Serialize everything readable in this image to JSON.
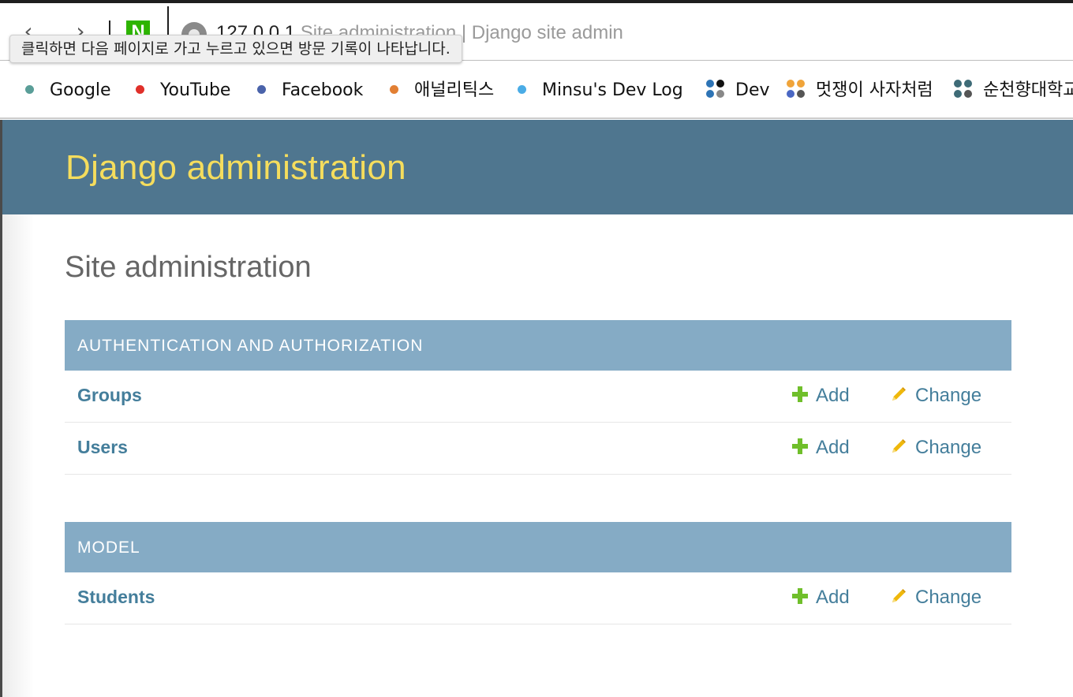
{
  "browser": {
    "back_glyph": "‹",
    "forward_glyph": "›",
    "naver_letter": "N",
    "url_host": "127.0.0.1",
    "tab_title": "Site administration | Django site admin",
    "tooltip": "클릭하면 다음 페이지로 가고 누르고 있으면 방문 기록이 나타납니다."
  },
  "bookmarks": [
    {
      "label": "Google",
      "color": "#5a9e98"
    },
    {
      "label": "YouTube",
      "color": "#e0302a"
    },
    {
      "label": "Facebook",
      "color": "#4a63aa"
    },
    {
      "label": "애널리틱스",
      "color": "#e27f33"
    },
    {
      "label": "Minsu's Dev Log",
      "color": "#4aace6"
    },
    {
      "label": "Dev",
      "colors": [
        "#2e74b5",
        "#111111",
        "#2e74b5",
        "#888888"
      ]
    },
    {
      "label": "멋쟁이 사자처럼",
      "colors": [
        "#f0a43a",
        "#f0a43a",
        "#4a67c3",
        "#555555"
      ]
    },
    {
      "label": "순천향대학교",
      "colors": [
        "#3e6b77",
        "#3e6b77",
        "#3e6b77",
        "#555555"
      ]
    }
  ],
  "header": {
    "brand": "Django administration"
  },
  "content": {
    "title": "Site administration",
    "modules": [
      {
        "caption": "AUTHENTICATION AND AUTHORIZATION",
        "models": [
          {
            "name": "Groups",
            "add": "Add",
            "change": "Change"
          },
          {
            "name": "Users",
            "add": "Add",
            "change": "Change"
          }
        ]
      },
      {
        "caption": "MODEL",
        "models": [
          {
            "name": "Students",
            "add": "Add",
            "change": "Change"
          }
        ]
      }
    ]
  },
  "colors": {
    "header_bg": "#4f768f",
    "brand_text": "#f5dd5d",
    "caption_bg": "#85abc5",
    "link": "#447e9b",
    "add_icon": "#70bf2b",
    "change_icon": "#efb80b"
  }
}
